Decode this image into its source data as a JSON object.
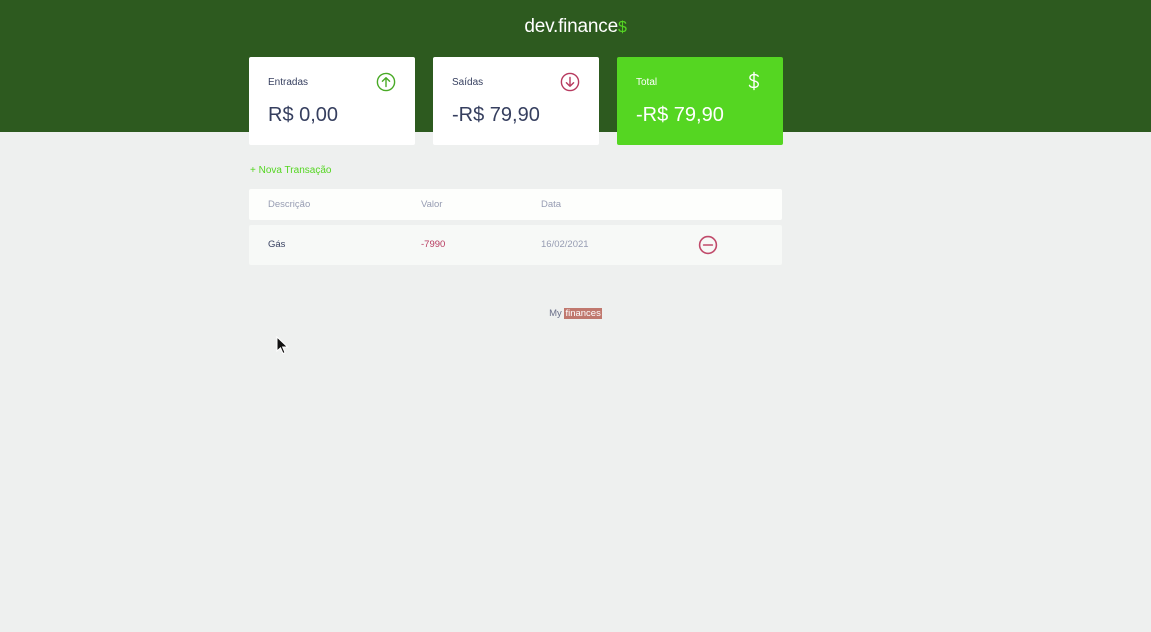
{
  "app": {
    "logo_main": "dev",
    "logo_dot": ".",
    "logo_rest": "finance",
    "logo_dollar": "$"
  },
  "cards": {
    "income": {
      "label": "Entradas",
      "value": "R$ 0,00",
      "icon": "arrow-up-circle-icon",
      "color": "#49aa26"
    },
    "expense": {
      "label": "Saídas",
      "value": "-R$ 79,90",
      "icon": "arrow-down-circle-icon",
      "color": "#b73a5f"
    },
    "total": {
      "label": "Total",
      "value": "-R$ 79,90",
      "icon": "dollar-icon",
      "color": "#55d622"
    }
  },
  "actions": {
    "new_transaction": "+ Nova Transação"
  },
  "table": {
    "headers": [
      "Descrição",
      "Valor",
      "Data"
    ],
    "rows": [
      {
        "description": "Gás",
        "amount": "-7990",
        "date": "16/02/2021",
        "action_icon": "minus-circle-icon"
      }
    ]
  },
  "footer": {
    "text_plain": "My",
    "text_selected": "finances"
  },
  "colors": {
    "header_bg": "#2d5a1f",
    "accent_green": "#55d622",
    "expense_red": "#b73a5f",
    "page_bg": "#eef0ef"
  }
}
